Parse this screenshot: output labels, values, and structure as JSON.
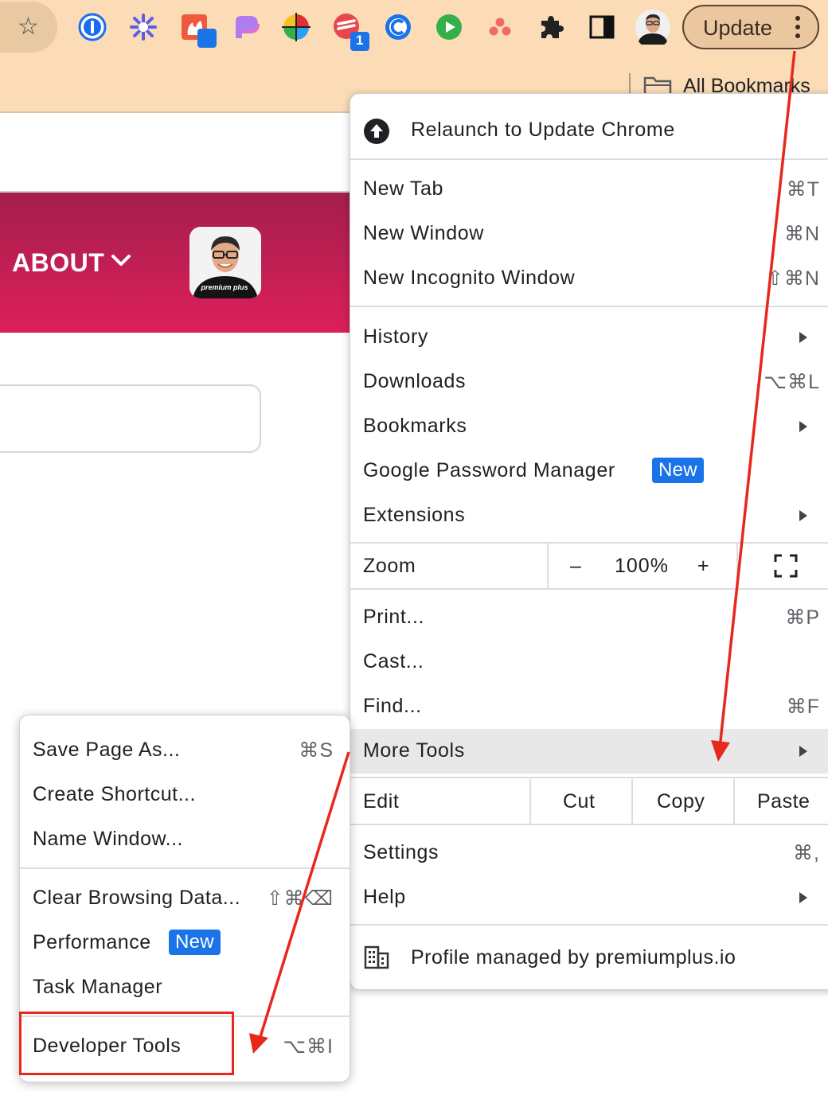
{
  "toolbar": {
    "update_label": "Update",
    "extensions": [
      {
        "icon": "1password-icon",
        "color": "#1a6df0"
      },
      {
        "icon": "asterisk-icon",
        "color": "#5b5fe8"
      },
      {
        "icon": "fire-extension-icon",
        "color": "#f05a3c"
      },
      {
        "icon": "pen-icon",
        "color": "#9b6df0"
      },
      {
        "icon": "color-wheel-icon",
        "color": "#e03030"
      },
      {
        "icon": "todoist-icon",
        "color": "#e8464c",
        "badge": "1"
      },
      {
        "icon": "c-extension-icon",
        "color": "#1a73e8"
      },
      {
        "icon": "play-icon",
        "color": "#34b04a"
      },
      {
        "icon": "asana-icon",
        "color": "#f06a6a"
      }
    ]
  },
  "bookmarks": {
    "all_label": "All Bookmarks"
  },
  "page": {
    "nav_about": "ABOUT",
    "shirt_text": "premium plus"
  },
  "menu": {
    "relaunch": "Relaunch to Update Chrome",
    "new_tab": {
      "label": "New Tab",
      "shortcut": "⌘T"
    },
    "new_window": {
      "label": "New Window",
      "shortcut": "⌘N"
    },
    "new_incognito": {
      "label": "New Incognito Window",
      "shortcut": "⇧⌘N"
    },
    "history": "History",
    "downloads": {
      "label": "Downloads",
      "shortcut": "⌥⌘L"
    },
    "bookmarks": "Bookmarks",
    "password_manager": {
      "label": "Google Password Manager",
      "badge": "New"
    },
    "extensions": "Extensions",
    "zoom": {
      "label": "Zoom",
      "minus": "–",
      "value": "100%",
      "plus": "+"
    },
    "print": {
      "label": "Print...",
      "shortcut": "⌘P"
    },
    "cast": "Cast...",
    "find": {
      "label": "Find...",
      "shortcut": "⌘F"
    },
    "more_tools": "More Tools",
    "edit": {
      "label": "Edit",
      "cut": "Cut",
      "copy": "Copy",
      "paste": "Paste"
    },
    "settings": {
      "label": "Settings",
      "shortcut": "⌘,"
    },
    "help": "Help",
    "profile": "Profile managed by premiumplus.io"
  },
  "submenu": {
    "save_page": {
      "label": "Save Page As...",
      "shortcut": "⌘S"
    },
    "create_shortcut": "Create Shortcut...",
    "name_window": "Name Window...",
    "clear_data": {
      "label": "Clear Browsing Data...",
      "shortcut": "⇧⌘⌫"
    },
    "performance": {
      "label": "Performance",
      "badge": "New"
    },
    "task_manager": "Task Manager",
    "developer_tools": {
      "label": "Developer Tools",
      "shortcut": "⌥⌘I"
    }
  },
  "colors": {
    "toolbar_bg": "#fbdcb6",
    "header_gradient_top": "#a31f4c",
    "header_gradient_bottom": "#dd1f5a",
    "badge_blue": "#1a73e8",
    "annotation_red": "#e8281c"
  }
}
